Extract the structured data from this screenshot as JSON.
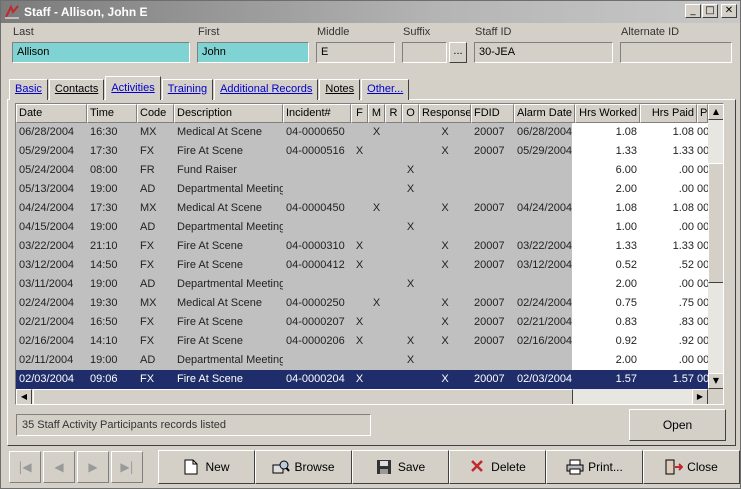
{
  "window": {
    "title": "Staff - Allison, John E"
  },
  "fields": {
    "last": {
      "label": "Last",
      "value": "Allison"
    },
    "first": {
      "label": "First",
      "value": "John"
    },
    "middle": {
      "label": "Middle",
      "value": "E"
    },
    "suffix": {
      "label": "Suffix",
      "value": ""
    },
    "staff_id": {
      "label": "Staff ID",
      "value": "30-JEA"
    },
    "alternate_id": {
      "label": "Alternate ID",
      "value": ""
    },
    "ellipsis": "..."
  },
  "tabs": [
    "Basic",
    "Contacts",
    "Activities",
    "Training",
    "Additional Records",
    "Notes",
    "Other..."
  ],
  "grid": {
    "columns": [
      "Date",
      "Time",
      "Code",
      "Description",
      "Incident#",
      "F",
      "M",
      "R",
      "O",
      "Response",
      "FDID",
      "Alarm Date",
      "Hrs Worked",
      "Hrs Paid",
      "Po"
    ],
    "rows": [
      [
        "06/28/2004",
        "16:30",
        "MX",
        "Medical At Scene",
        "04-0000650",
        "",
        "X",
        "",
        "",
        "X",
        "20007",
        "06/28/2004",
        "1.08",
        "1.08",
        "00"
      ],
      [
        "05/29/2004",
        "17:30",
        "FX",
        "Fire At Scene",
        "04-0000516",
        "X",
        "",
        "",
        "",
        "X",
        "20007",
        "05/29/2004",
        "1.33",
        "1.33",
        "00"
      ],
      [
        "05/24/2004",
        "08:00",
        "FR",
        "Fund Raiser",
        "",
        "",
        "",
        "",
        "X",
        "",
        "",
        "",
        "6.00",
        ".00",
        "00"
      ],
      [
        "05/13/2004",
        "19:00",
        "AD",
        "Departmental Meeting/",
        "",
        "",
        "",
        "",
        "X",
        "",
        "",
        "",
        "2.00",
        ".00",
        "00"
      ],
      [
        "04/24/2004",
        "17:30",
        "MX",
        "Medical At Scene",
        "04-0000450",
        "",
        "X",
        "",
        "",
        "X",
        "20007",
        "04/24/2004",
        "1.08",
        "1.08",
        "00"
      ],
      [
        "04/15/2004",
        "19:00",
        "AD",
        "Departmental Meeting/",
        "",
        "",
        "",
        "",
        "X",
        "",
        "",
        "",
        "1.00",
        ".00",
        "00"
      ],
      [
        "03/22/2004",
        "21:10",
        "FX",
        "Fire At Scene",
        "04-0000310",
        "X",
        "",
        "",
        "",
        "X",
        "20007",
        "03/22/2004",
        "1.33",
        "1.33",
        "00"
      ],
      [
        "03/12/2004",
        "14:50",
        "FX",
        "Fire At Scene",
        "04-0000412",
        "X",
        "",
        "",
        "",
        "X",
        "20007",
        "03/12/2004",
        "0.52",
        ".52",
        "00"
      ],
      [
        "03/11/2004",
        "19:00",
        "AD",
        "Departmental Meeting/",
        "",
        "",
        "",
        "",
        "X",
        "",
        "",
        "",
        "2.00",
        ".00",
        "00"
      ],
      [
        "02/24/2004",
        "19:30",
        "MX",
        "Medical At Scene",
        "04-0000250",
        "",
        "X",
        "",
        "",
        "X",
        "20007",
        "02/24/2004",
        "0.75",
        ".75",
        "00"
      ],
      [
        "02/21/2004",
        "16:50",
        "FX",
        "Fire At Scene",
        "04-0000207",
        "X",
        "",
        "",
        "",
        "X",
        "20007",
        "02/21/2004",
        "0.83",
        ".83",
        "00"
      ],
      [
        "02/16/2004",
        "14:10",
        "FX",
        "Fire At Scene",
        "04-0000206",
        "X",
        "",
        "",
        "X",
        "X",
        "20007",
        "02/16/2004",
        "0.92",
        ".92",
        "00"
      ],
      [
        "02/11/2004",
        "19:00",
        "AD",
        "Departmental Meeting/",
        "",
        "",
        "",
        "",
        "X",
        "",
        "",
        "",
        "2.00",
        ".00",
        "00"
      ],
      [
        "02/03/2004",
        "09:06",
        "FX",
        "Fire At Scene",
        "04-0000204",
        "X",
        "",
        "",
        "",
        "X",
        "20007",
        "02/03/2004",
        "1.57",
        "1.57",
        "00"
      ]
    ],
    "selected_row": 13
  },
  "status": {
    "text": "35 Staff Activity Participants records listed"
  },
  "buttons": {
    "open": "Open",
    "new": "New",
    "browse": "Browse",
    "save": "Save",
    "delete": "Delete",
    "print": "Print...",
    "close": "Close"
  },
  "colors": {
    "selection": "#1f2d6a",
    "field_highlight": "#7fd3d3",
    "delete_x": "#c0282d"
  }
}
